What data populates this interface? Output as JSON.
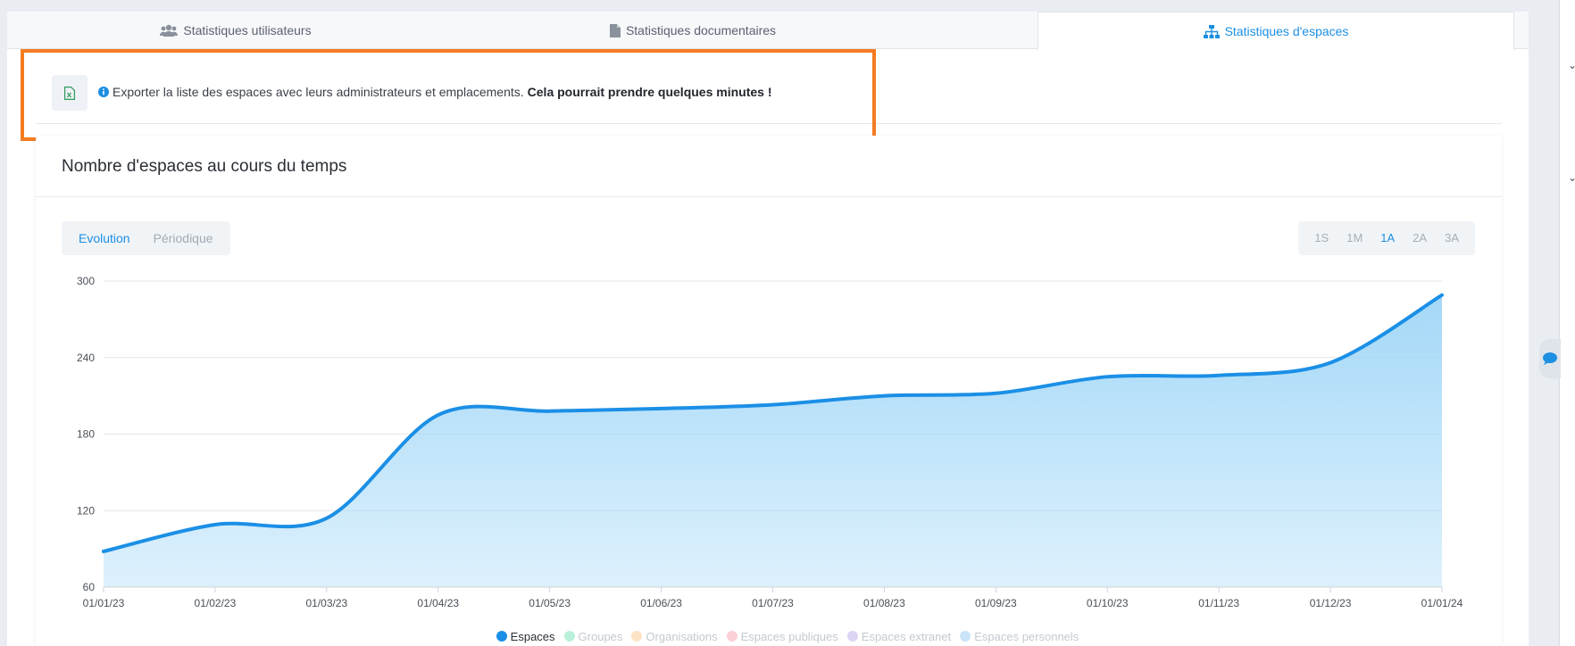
{
  "tabs": [
    {
      "label": "Statistiques utilisateurs",
      "icon": "users-icon"
    },
    {
      "label": "Statistiques documentaires",
      "icon": "document-icon"
    },
    {
      "label": "Statistiques d'espaces",
      "icon": "sitemap-icon",
      "active": true
    }
  ],
  "export": {
    "text": "Exporter la liste des espaces avec leurs administrateurs et emplacements.",
    "warning": "Cela pourrait prendre quelques minutes !",
    "icon": "excel-file-icon"
  },
  "card": {
    "title": "Nombre d'espaces au cours du temps",
    "view_modes": [
      "Evolution",
      "Périodique"
    ],
    "active_view": "Evolution",
    "ranges": [
      "1S",
      "1M",
      "1A",
      "2A",
      "3A"
    ],
    "active_range": "1A"
  },
  "colors": {
    "accent": "#1c8fe3",
    "highlight": "#f47c20",
    "series_line": "#1b8fe6",
    "series_fill": "#9fd6f7"
  },
  "chart_data": {
    "type": "area",
    "x": [
      "01/01/23",
      "01/02/23",
      "01/03/23",
      "01/04/23",
      "01/05/23",
      "01/06/23",
      "01/07/23",
      "01/08/23",
      "01/09/23",
      "01/10/23",
      "01/11/23",
      "01/12/23",
      "01/01/24"
    ],
    "series": [
      {
        "name": "Espaces",
        "values": [
          88,
          109,
          114,
          195,
          198,
          200,
          203,
          210,
          212,
          225,
          226,
          236,
          289
        ]
      }
    ],
    "yticks": [
      60,
      120,
      180,
      240,
      300
    ],
    "ylim": [
      60,
      300
    ],
    "grid": true,
    "legend": [
      {
        "name": "Espaces",
        "color": "#1b8fe6",
        "active": true
      },
      {
        "name": "Groupes",
        "color": "#b9f0d9",
        "active": false
      },
      {
        "name": "Organisations",
        "color": "#fde3c5",
        "active": false
      },
      {
        "name": "Espaces publiques",
        "color": "#fbd0d6",
        "active": false
      },
      {
        "name": "Espaces extranet",
        "color": "#dcd6f4",
        "active": false
      },
      {
        "name": "Espaces personnels",
        "color": "#c9e4f7",
        "active": false
      }
    ],
    "legend_position": "bottom"
  }
}
